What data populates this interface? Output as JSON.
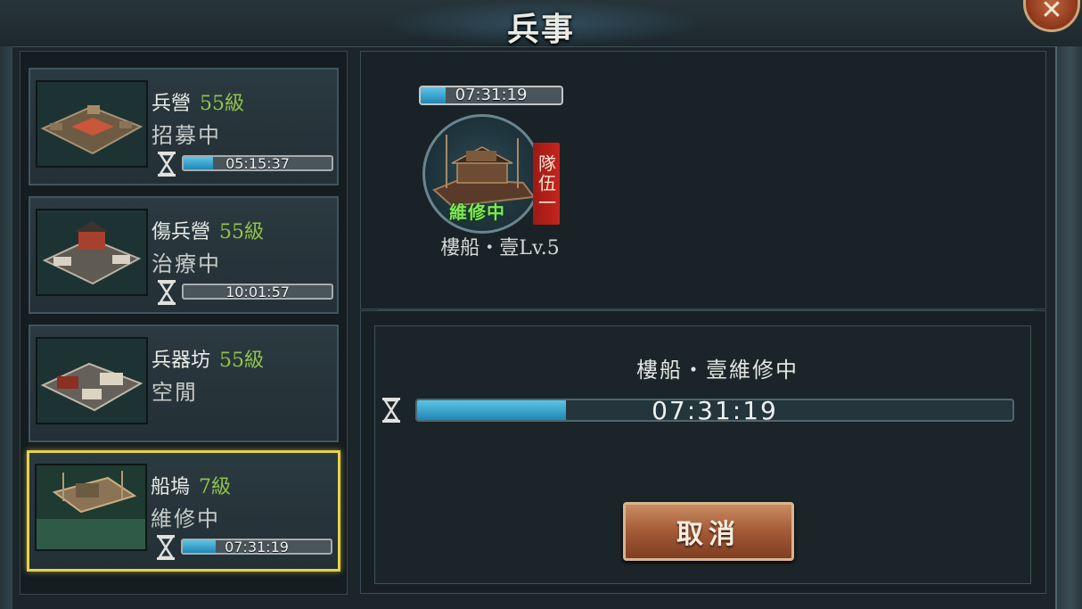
{
  "window": {
    "title": "兵事",
    "close_label": "✕"
  },
  "buildings": [
    {
      "name": "兵營",
      "level": "55級",
      "status": "招募中",
      "timer": "05:15:37",
      "progress": 0.2,
      "selected": false
    },
    {
      "name": "傷兵營",
      "level": "55級",
      "status": "治療中",
      "timer": "10:01:57",
      "progress": 0.0,
      "selected": false
    },
    {
      "name": "兵器坊",
      "level": "55級",
      "status": "空閒",
      "timer": "",
      "progress": 0,
      "selected": false
    },
    {
      "name": "船塢",
      "level": "7級",
      "status": "維修中",
      "timer": "07:31:19",
      "progress": 0.22,
      "selected": true
    }
  ],
  "fleet": {
    "timer": "07:31:19",
    "progress": 0.18,
    "repair_label": "維修中",
    "team_tag": "隊伍一",
    "ship_name": "樓船・壹Lv.5"
  },
  "detail": {
    "title": "樓船・壹維修中",
    "timer": "07:31:19",
    "progress": 0.25,
    "cancel_label": "取消"
  },
  "icons": {
    "hourglass": "hourglass-icon",
    "close": "close-icon"
  },
  "colors": {
    "level_green": "#8fc34c",
    "progress_blue": "#3aa6d2",
    "selected_border": "#e5d24a",
    "team_tag_red": "#c6251d",
    "cancel_button": "#a35a37"
  }
}
